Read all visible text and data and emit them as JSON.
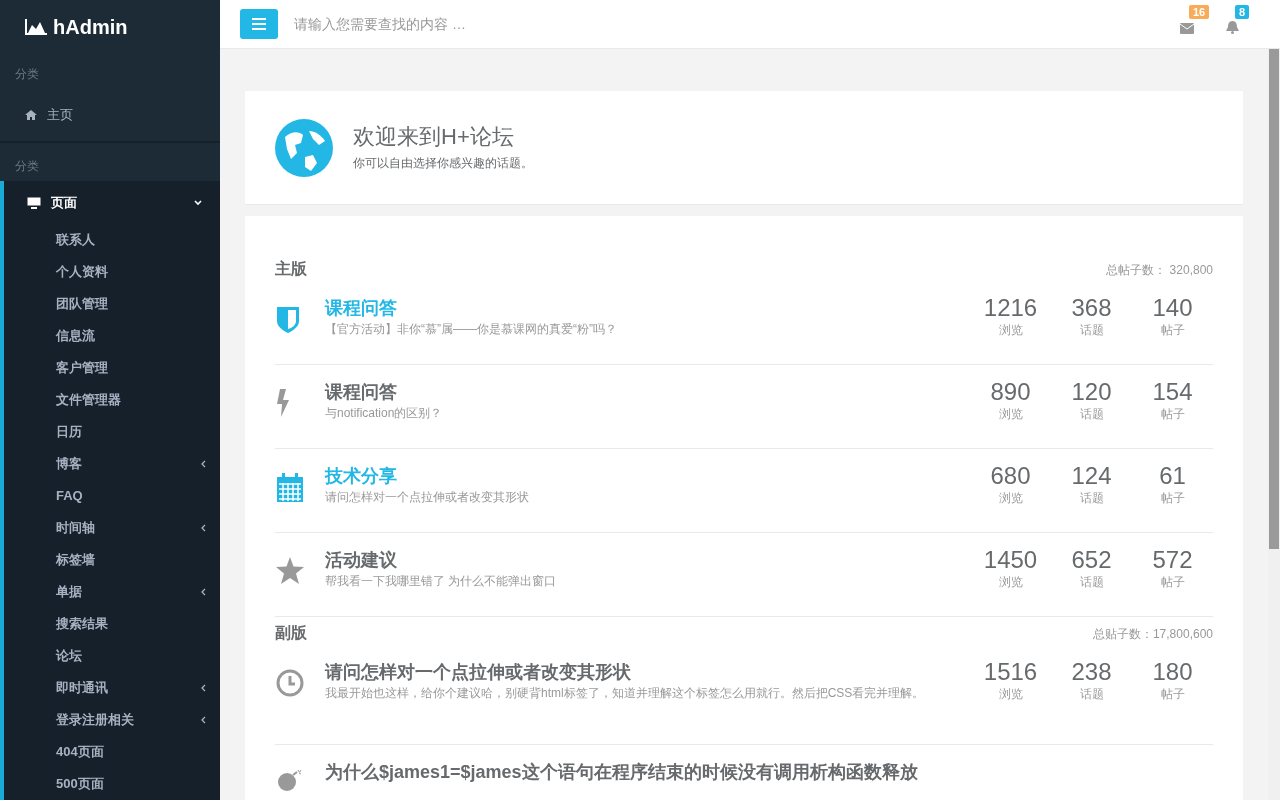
{
  "sidebar": {
    "logo": "hAdmin",
    "sections": [
      {
        "heading": "分类",
        "items": [
          {
            "label": "主页",
            "expanded": false
          }
        ]
      },
      {
        "heading": "分类",
        "items": [
          {
            "label": "页面",
            "expanded": true,
            "children": [
              {
                "label": "联系人",
                "has_submenu": false
              },
              {
                "label": "个人资料",
                "has_submenu": false
              },
              {
                "label": "团队管理",
                "has_submenu": false
              },
              {
                "label": "信息流",
                "has_submenu": false
              },
              {
                "label": "客户管理",
                "has_submenu": false
              },
              {
                "label": "文件管理器",
                "has_submenu": false
              },
              {
                "label": "日历",
                "has_submenu": false
              },
              {
                "label": "博客",
                "has_submenu": true
              },
              {
                "label": "FAQ",
                "has_submenu": false
              },
              {
                "label": "时间轴",
                "has_submenu": true
              },
              {
                "label": "标签墙",
                "has_submenu": false
              },
              {
                "label": "单据",
                "has_submenu": true
              },
              {
                "label": "搜索结果",
                "has_submenu": false
              },
              {
                "label": "论坛",
                "has_submenu": false
              },
              {
                "label": "即时通讯",
                "has_submenu": true
              },
              {
                "label": "登录注册相关",
                "has_submenu": true
              },
              {
                "label": "404页面",
                "has_submenu": false
              },
              {
                "label": "500页面",
                "has_submenu": false
              }
            ]
          }
        ]
      }
    ]
  },
  "topbar": {
    "search_placeholder": "请输入您需要查找的内容 …",
    "badges": [
      {
        "count": "16",
        "color": "#f8ac59"
      },
      {
        "count": "8",
        "color": "#23b7e5"
      }
    ]
  },
  "welcome": {
    "title": "欢迎来到H+论坛",
    "subtitle": "你可以自由选择你感兴趣的话题。"
  },
  "forum_sections": [
    {
      "title": "主版",
      "total": "总帖子数： 320,800",
      "rows": [
        {
          "title": "课程问答",
          "highlighted": true,
          "description": "【官方活动】非你“慕”属——你是慕课网的真爱“粉”吗？",
          "stats": [
            {
              "value": "1216",
              "label": "浏览"
            },
            {
              "value": "368",
              "label": "话题"
            },
            {
              "value": "140",
              "label": "帖子"
            }
          ]
        },
        {
          "title": "课程问答",
          "highlighted": false,
          "description": "与notification的区别？",
          "stats": [
            {
              "value": "890",
              "label": "浏览"
            },
            {
              "value": "120",
              "label": "话题"
            },
            {
              "value": "154",
              "label": "帖子"
            }
          ]
        },
        {
          "title": "技术分享",
          "highlighted": true,
          "description": "请问怎样对一个点拉伸或者改变其形状",
          "stats": [
            {
              "value": "680",
              "label": "浏览"
            },
            {
              "value": "124",
              "label": "话题"
            },
            {
              "value": "61",
              "label": "帖子"
            }
          ]
        },
        {
          "title": "活动建议",
          "highlighted": false,
          "description": "帮我看一下我哪里错了 为什么不能弹出窗口",
          "stats": [
            {
              "value": "1450",
              "label": "浏览"
            },
            {
              "value": "652",
              "label": "话题"
            },
            {
              "value": "572",
              "label": "帖子"
            }
          ]
        }
      ]
    },
    {
      "title": "副版",
      "total": "总贴子数：17,800,600",
      "rows": [
        {
          "title": "请问怎样对一个点拉伸或者改变其形状",
          "highlighted": false,
          "description": "我最开始也这样，给你个建议哈，别硬背html标签了，知道并理解这个标签怎么用就行。然后把CSS看完并理解。",
          "stats": [
            {
              "value": "1516",
              "label": "浏览"
            },
            {
              "value": "238",
              "label": "话题"
            },
            {
              "value": "180",
              "label": "帖子"
            }
          ]
        },
        {
          "title": "为什么$james1=$james这个语句在程序结束的时候没有调用析构函数释放",
          "highlighted": false
        }
      ]
    }
  ]
}
